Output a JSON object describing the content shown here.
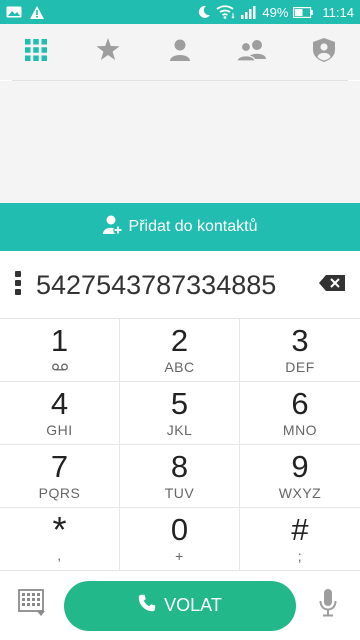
{
  "status_bar": {
    "battery": "49%",
    "time": "11:14",
    "left_icons": [
      "image-icon",
      "warning-icon"
    ],
    "right_icons": [
      "moon-icon",
      "wifi-icon",
      "signal-icon",
      "battery-icon"
    ]
  },
  "tabs": [
    {
      "icon": "dialpad-icon",
      "active": true
    },
    {
      "icon": "star-icon",
      "active": false
    },
    {
      "icon": "person-icon",
      "active": false
    },
    {
      "icon": "group-icon",
      "active": false
    },
    {
      "icon": "shield-person-icon",
      "active": false
    }
  ],
  "add_contact": {
    "label": "Přidat do kontaktů",
    "icon": "add-person-icon"
  },
  "number": "5427543787334885",
  "keys": [
    {
      "digit": "1",
      "letters": "",
      "sub_icon": "voicemail-icon"
    },
    {
      "digit": "2",
      "letters": "ABC"
    },
    {
      "digit": "3",
      "letters": "DEF"
    },
    {
      "digit": "4",
      "letters": "GHI"
    },
    {
      "digit": "5",
      "letters": "JKL"
    },
    {
      "digit": "6",
      "letters": "MNO"
    },
    {
      "digit": "7",
      "letters": "PQRS"
    },
    {
      "digit": "8",
      "letters": "TUV"
    },
    {
      "digit": "9",
      "letters": "WXYZ"
    },
    {
      "digit": "*",
      "letters": ","
    },
    {
      "digit": "0",
      "letters": "+"
    },
    {
      "digit": "#",
      "letters": ";"
    }
  ],
  "call_button": {
    "label": "VOLAT",
    "icon": "phone-icon"
  },
  "colors": {
    "accent": "#21bdb0",
    "call": "#22b889",
    "icon_grey": "#9e9e9e"
  }
}
